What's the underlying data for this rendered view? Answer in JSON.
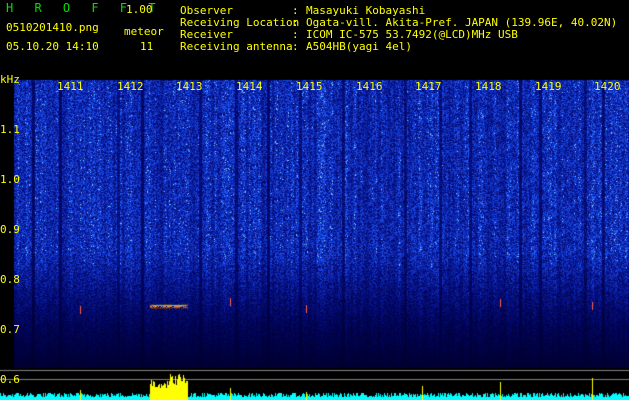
{
  "header": {
    "app_title": "H R O F F T",
    "version": "1.00",
    "filename": "0510201410.png",
    "datetime": "05.10.20 14:10",
    "meteor_label": "meteor",
    "meteor_count": "11",
    "info": [
      {
        "label": "Observer",
        "value": "Masayuki Kobayashi"
      },
      {
        "label": "Receiving Location",
        "value": "Ogata-vill. Akita-Pref. JAPAN (139.96E, 40.02N)"
      },
      {
        "label": "Receiver",
        "value": "ICOM IC-575 53.7492(@LCD)MHz USB"
      },
      {
        "label": "Receiving antenna",
        "value": "A504HB(yagi 4el)"
      }
    ]
  },
  "axis": {
    "unit": "kHz",
    "time_ticks": [
      "1411",
      "1412",
      "1413",
      "1414",
      "1415",
      "1416",
      "1417",
      "1418",
      "1419",
      "1420"
    ],
    "freq_ticks": [
      "1.1",
      "1.0",
      "0.9",
      "0.8",
      "0.7",
      "0.6"
    ]
  },
  "colors": {
    "text": "#ffff00",
    "title": "#00e000",
    "signal": "#00ffff"
  }
}
